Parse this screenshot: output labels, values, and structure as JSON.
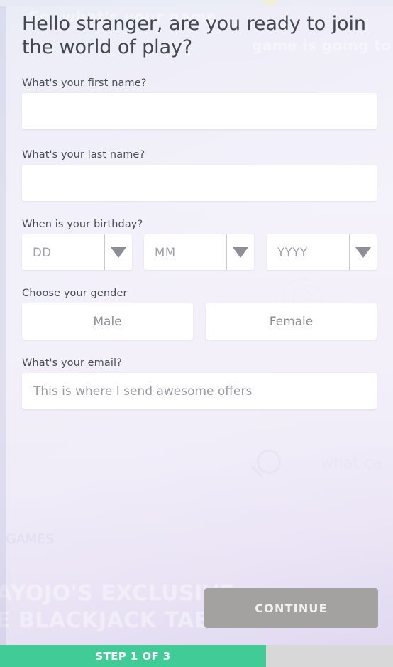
{
  "background": {
    "ghost_headline_left": "So, what's your name",
    "ghost_headline_right": "game is going to be your",
    "ghost_games_label": "GAMES",
    "ghost_what_label": "what ca",
    "ghost_banner_line1": "AYOJO'S EXCLUSIVE",
    "ghost_banner_line2": "E BLACKJACK TABLE",
    "magnifier_icon": "search-icon"
  },
  "form": {
    "headline": "Hello stranger, are you ready to join the world of play?",
    "first_name": {
      "label": "What's your first name?",
      "value": "",
      "placeholder": ""
    },
    "last_name": {
      "label": "What's your last name?",
      "value": "",
      "placeholder": ""
    },
    "birthday": {
      "label": "When is your birthday?",
      "day": {
        "selected": "DD",
        "arrow_icon": "chevron-down-icon"
      },
      "month": {
        "selected": "MM",
        "arrow_icon": "chevron-down-icon"
      },
      "year": {
        "selected": "YYYY",
        "arrow_icon": "chevron-down-icon"
      }
    },
    "gender": {
      "label": "Choose your gender",
      "male_label": "Male",
      "female_label": "Female",
      "selected": ""
    },
    "email": {
      "label": "What's your email?",
      "value": "",
      "placeholder": "This is where I send awesome offers"
    }
  },
  "footer": {
    "continue_label": "CONTINUE",
    "continue_enabled": false,
    "progress_label": "STEP 1 OF 3",
    "progress_current_step": 1,
    "progress_total_steps": 3
  },
  "colors": {
    "progress_fill": "#41cb96",
    "progress_track": "#d8d8d8",
    "continue_disabled": "#a3a2a0",
    "page_background": "#dcd9ee",
    "field_background": "#ffffff",
    "label_text": "#4a4e57"
  }
}
